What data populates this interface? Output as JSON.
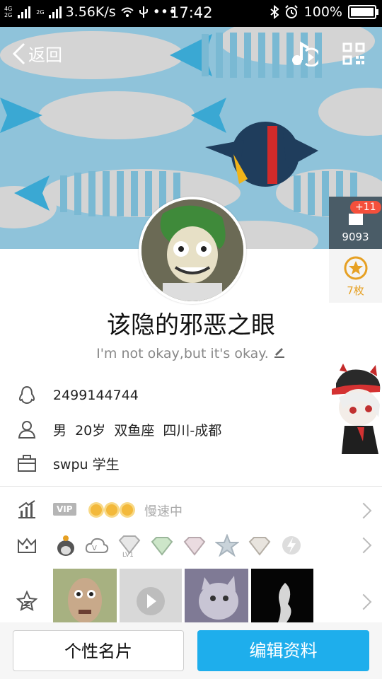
{
  "status_bar": {
    "network_top": "4G",
    "network_bottom": "2G",
    "network_mid": "2G",
    "speed": "3.56K/s",
    "more": "•••",
    "time": "17:42",
    "battery": "100%"
  },
  "header": {
    "back_label": "返回"
  },
  "side": {
    "likes_badge": "+11",
    "likes_count": "9093",
    "medal_count": "7枚"
  },
  "profile": {
    "name": "该隐的邪恶之眼",
    "signature": "I'm not okay,but it's okay.",
    "qq_number": "2499144744",
    "personal": "男  20岁  双鱼座  四川-成都",
    "occupation": "swpu 学生"
  },
  "vip_row": {
    "vip_label": "VIP",
    "status": "慢速中"
  },
  "badges_row": {
    "level_text": "LV1"
  },
  "buttons": {
    "card": "个性名片",
    "edit": "编辑资料"
  },
  "colors": {
    "accent": "#1eaeec",
    "cover_bg": "#8fc3da",
    "badge": "#f4503c",
    "medal": "#e6a023"
  }
}
